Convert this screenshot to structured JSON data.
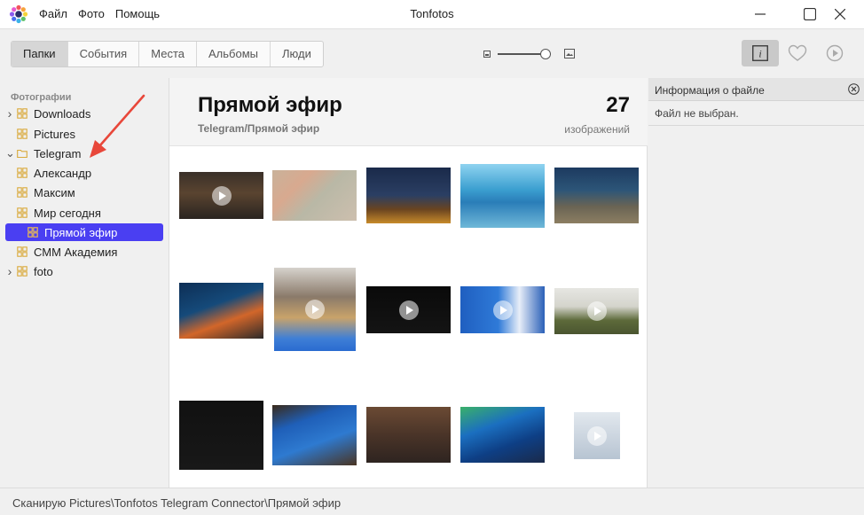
{
  "app": {
    "title": "Tonfotos",
    "menu": [
      "Файл",
      "Фото",
      "Помощь"
    ]
  },
  "toolbar": {
    "tabs": [
      "Папки",
      "События",
      "Места",
      "Альбомы",
      "Люди"
    ],
    "active_tab": "Папки",
    "zoom_level": 0.9
  },
  "sidebar": {
    "heading": "Фотографии",
    "items": [
      {
        "label": "Downloads",
        "expand": "collapsed"
      },
      {
        "label": "Pictures",
        "expand": "none"
      },
      {
        "label": "Telegram",
        "expand": "expanded"
      },
      {
        "label": "Александр",
        "expand": "none"
      },
      {
        "label": "Максим",
        "expand": "none"
      },
      {
        "label": "Мир сегодня",
        "expand": "none"
      },
      {
        "label": "Прямой эфир",
        "expand": "none",
        "selected": true
      },
      {
        "label": "СММ Академия",
        "expand": "none"
      },
      {
        "label": "foto",
        "expand": "collapsed"
      }
    ]
  },
  "main": {
    "title": "Прямой эфир",
    "path": "Telegram/Прямой эфир",
    "count": "27",
    "count_label": "изображений"
  },
  "thumbnails": [
    {
      "name": "night-street-video",
      "video": true
    },
    {
      "name": "map-image",
      "video": false
    },
    {
      "name": "crane-night-photo",
      "video": false
    },
    {
      "name": "bridge-construction-photo",
      "video": false
    },
    {
      "name": "military-vehicle-photo",
      "video": false
    },
    {
      "name": "worker-orange-photo",
      "video": false
    },
    {
      "name": "collage-video",
      "video": true
    },
    {
      "name": "dark-screen-video",
      "video": true
    },
    {
      "name": "speaker-banner-video",
      "video": true
    },
    {
      "name": "officer-portrait-video",
      "video": true
    },
    {
      "name": "social-post-screenshot",
      "video": false
    },
    {
      "name": "tv-presenter-photo",
      "video": false
    },
    {
      "name": "meeting-room-photo",
      "video": false
    },
    {
      "name": "russia-emblem-photo",
      "video": false
    },
    {
      "name": "small-video-thumb",
      "video": true
    }
  ],
  "info_panel": {
    "title": "Информация о файле",
    "empty_text": "Файл не выбран."
  },
  "status": {
    "text": "Сканирую Pictures\\Tonfotos Telegram Connector\\Прямой эфир"
  },
  "colors": {
    "accent": "#4a3ff2",
    "arrow": "#e8473a"
  }
}
